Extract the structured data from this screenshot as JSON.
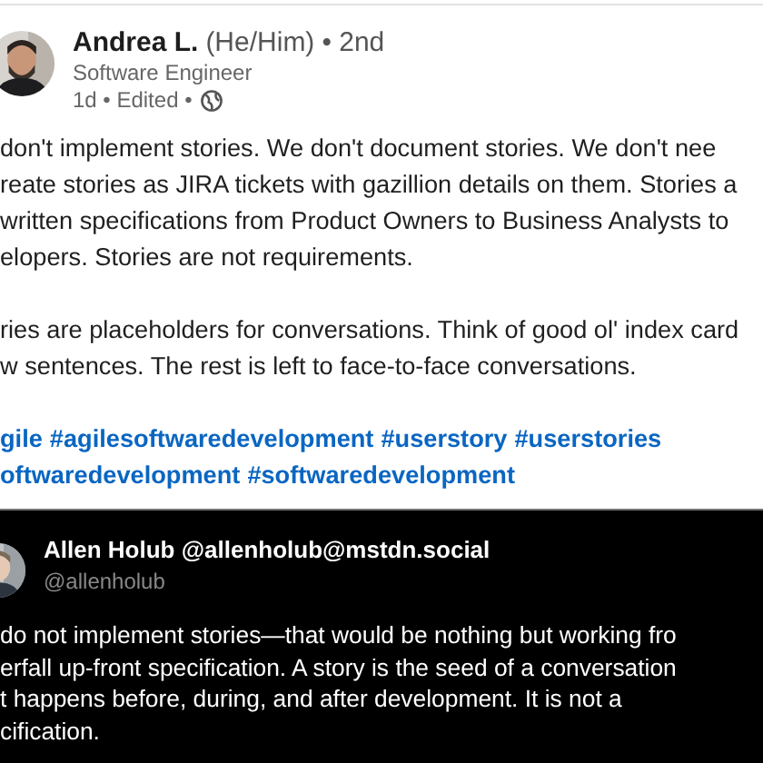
{
  "post": {
    "author": {
      "name": "Andrea L.",
      "pronouns": "(He/Him)",
      "degree": "• 2nd",
      "headline": "Software Engineer",
      "meta": "1d • Edited •"
    },
    "paragraphs": [
      [
        "don't implement stories. We don't document stories. We don't nee",
        "reate stories as JIRA tickets with gazillion details on them. Stories a",
        "written specifications from Product Owners to Business Analysts to",
        "elopers. Stories are not requirements."
      ],
      [
        "ries are placeholders for conversations. Think of good ol' index card",
        "w sentences. The rest is left to face-to-face conversations."
      ]
    ],
    "hashtag_lines": [
      [
        "gile",
        "#agilesoftwaredevelopment",
        "#userstory",
        "#userstories"
      ],
      [
        "oftwaredevelopment",
        "#softwaredevelopment"
      ]
    ]
  },
  "quoted_post": {
    "name": "Allen Holub @allenholub@mstdn.social",
    "handle": "@allenholub",
    "lines": [
      "do not implement stories—that would be nothing but working fro",
      "erfall up-front specification. A story is the seed of a conversation",
      "t happens before, during, and after development. It is not a",
      "cification."
    ]
  }
}
